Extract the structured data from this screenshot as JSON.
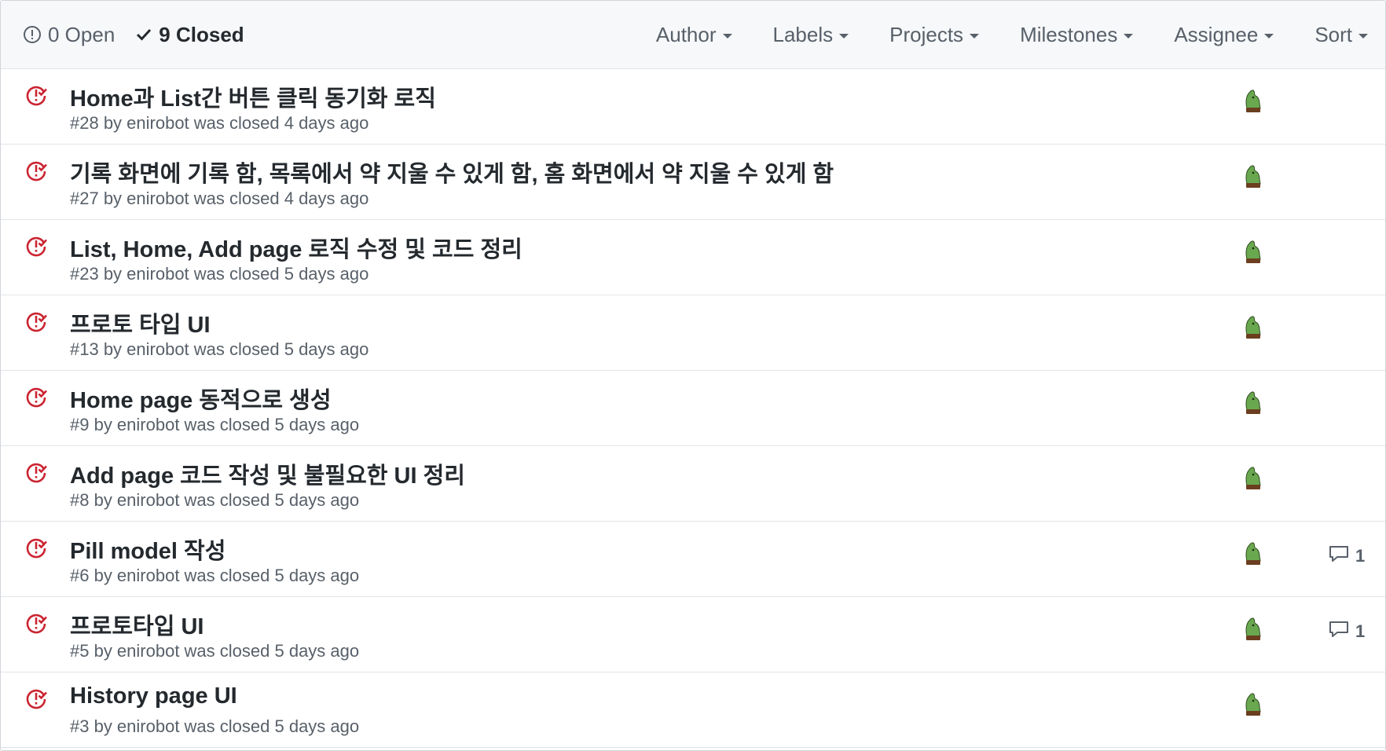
{
  "states": {
    "open_label": "0 Open",
    "closed_label": "9 Closed"
  },
  "filters": {
    "author": "Author",
    "labels": "Labels",
    "projects": "Projects",
    "milestones": "Milestones",
    "assignee": "Assignee",
    "sort": "Sort"
  },
  "colors": {
    "closed_icon": "#cb2431",
    "avatar_green": "#6aa84f"
  },
  "issues": [
    {
      "title": "Home과 List간 버튼 클릭 동기화 로직",
      "meta": "#28 by enirobot was closed 4 days ago",
      "comments": ""
    },
    {
      "title": "기록 화면에 기록 함, 목록에서 약 지울 수 있게 함, 홈 화면에서 약 지울 수 있게 함",
      "meta": "#27 by enirobot was closed 4 days ago",
      "comments": ""
    },
    {
      "title": "List, Home, Add page 로직 수정 및 코드 정리",
      "meta": "#23 by enirobot was closed 5 days ago",
      "comments": ""
    },
    {
      "title": "프로토 타입 UI",
      "meta": "#13 by enirobot was closed 5 days ago",
      "comments": ""
    },
    {
      "title": "Home page 동적으로 생성",
      "meta": "#9 by enirobot was closed 5 days ago",
      "comments": ""
    },
    {
      "title": "Add page 코드 작성 및 불필요한 UI 정리",
      "meta": "#8 by enirobot was closed 5 days ago",
      "comments": ""
    },
    {
      "title": "Pill model 작성",
      "meta": "#6 by enirobot was closed 5 days ago",
      "comments": "1"
    },
    {
      "title": "프로토타입 UI",
      "meta": "#5 by enirobot was closed 5 days ago",
      "comments": "1"
    },
    {
      "title": "History page UI",
      "meta": "#3 by enirobot was closed 5 days ago",
      "comments": ""
    }
  ]
}
